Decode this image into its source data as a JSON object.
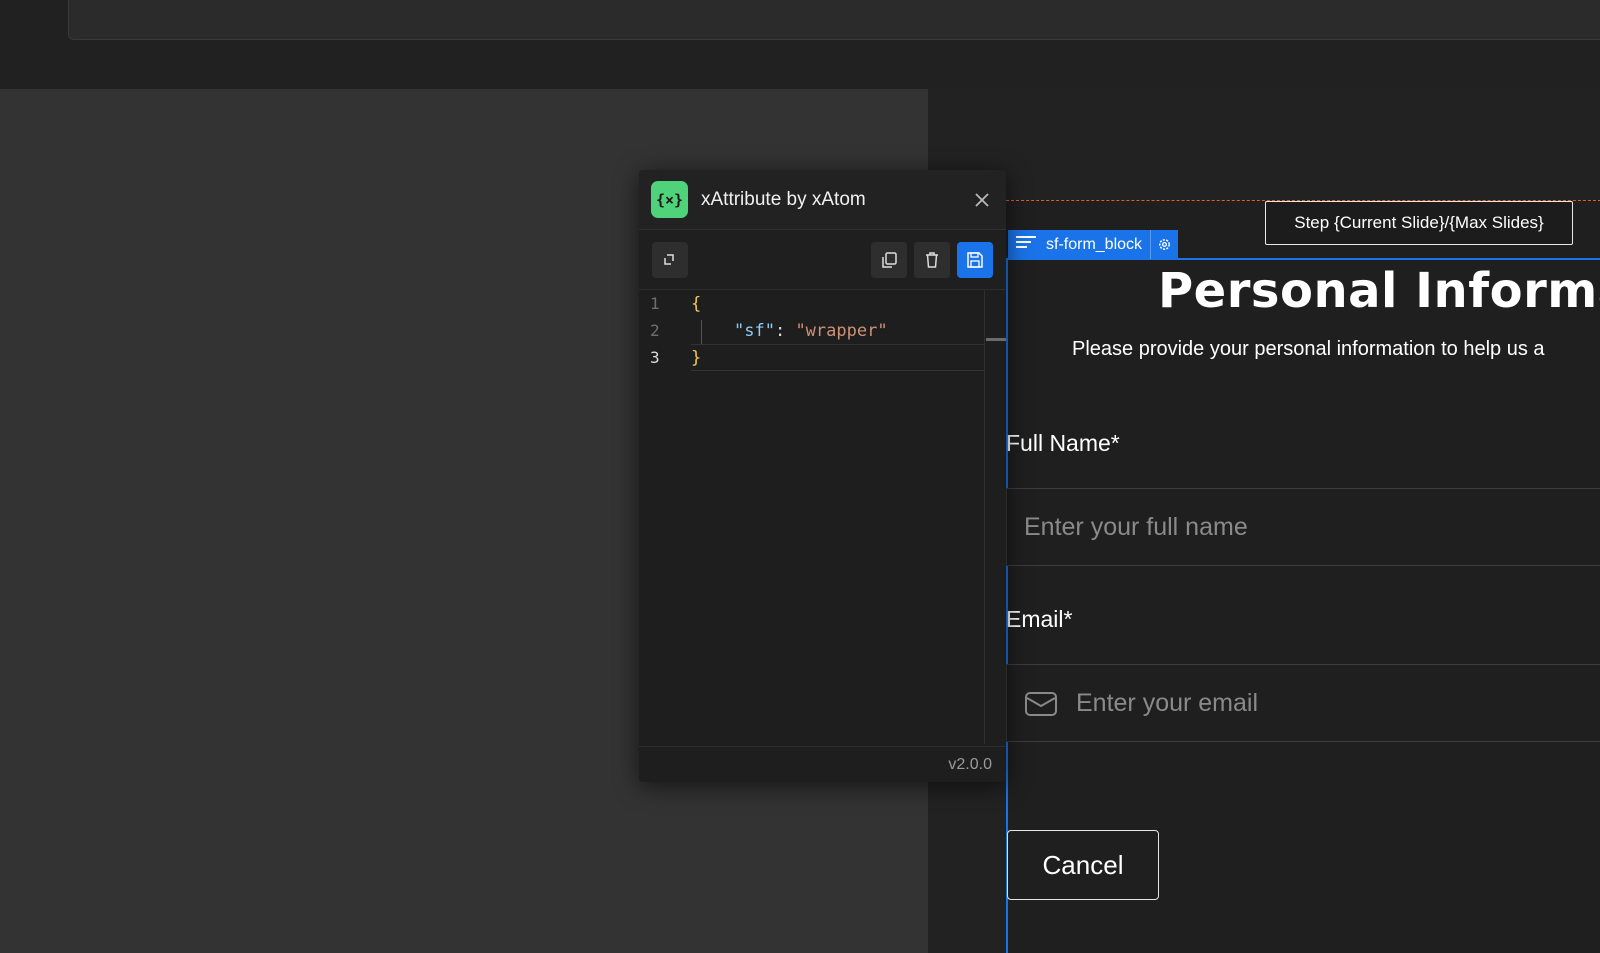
{
  "colors": {
    "accent": "#1a73e8",
    "logo_green": "#4fd27a",
    "dashed_outline": "#d9622b"
  },
  "xattribute_panel": {
    "logo_text": "{×}",
    "title": "xAttribute by xAtom",
    "close_icon": "×",
    "toolbar": {
      "left_icon": "expand-icon",
      "right_icons": [
        "copy-icon",
        "trash-icon",
        "save-icon"
      ]
    },
    "editor": {
      "line_numbers": [
        "1",
        "2",
        "3"
      ],
      "open_brace": "{",
      "key": "\"sf\"",
      "colon": ": ",
      "value": "\"wrapper\"",
      "close_brace": "}"
    },
    "version": "v2.0.0"
  },
  "canvas": {
    "block_tag": {
      "label": "sf-form_block",
      "icon": "menu-lines-icon",
      "gear_icon": "gear-icon"
    },
    "step_tag": "Step {Current Slide}/{Max Slides}",
    "form": {
      "title": "Personal Informat",
      "subtitle": "Please provide your personal information to help us a",
      "full_name_label": "Full Name*",
      "full_name_placeholder": "Enter your full name",
      "email_label": "Email*",
      "email_placeholder": "Enter your email",
      "cancel_label": "Cancel"
    }
  }
}
